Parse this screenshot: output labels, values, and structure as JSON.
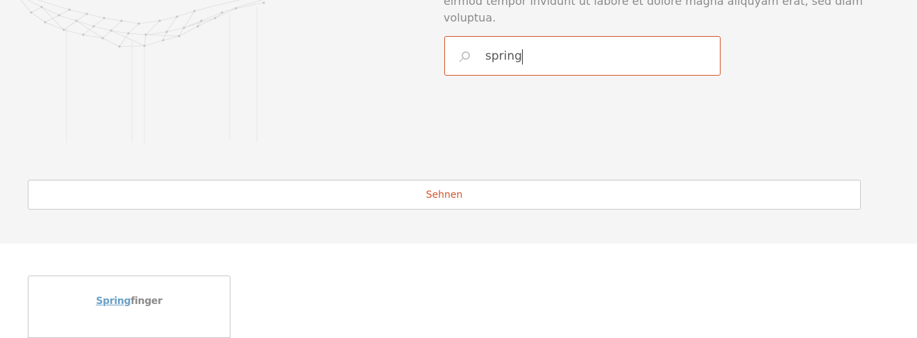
{
  "hero": {
    "intro_line1": "eirmod tempor invidunt ut labore et dolore magna aliquyam erat, sed diam",
    "intro_line2": "voluptua."
  },
  "search": {
    "value": "spring",
    "icon": "search-icon"
  },
  "actions": {
    "search_button_label": "Sehnen"
  },
  "results": {
    "items": [
      {
        "match": "Spring",
        "rest": "finger"
      }
    ]
  },
  "colors": {
    "accent": "#d2542a",
    "link": "#6aa0c7",
    "hero_bg": "#f5f5f5",
    "muted_text": "#8a8a8a"
  }
}
